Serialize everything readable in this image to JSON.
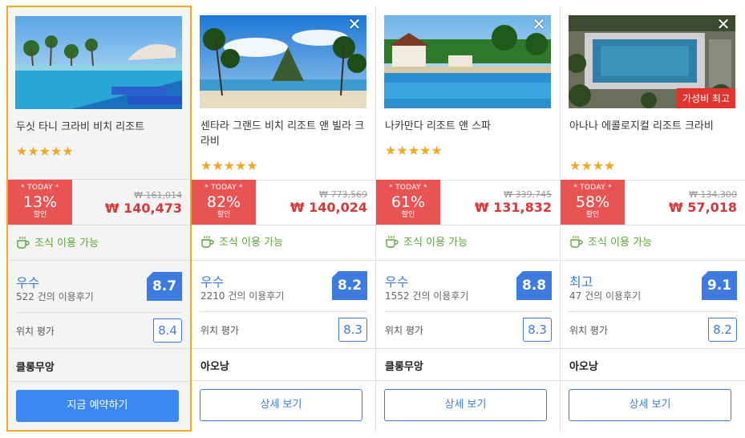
{
  "hotels": [
    {
      "name": "두싯 타니 크라비 비치 리조트",
      "stars": "★★★★★",
      "today_label": "* TODAY *",
      "discount": "13%",
      "discount_label": "할인",
      "original_price": "₩ 161,014",
      "price": "₩ 140,473",
      "breakfast": "조식 이용 가능",
      "grade": "우수",
      "reviews": "522 건의 이용후기",
      "score": "8.7",
      "location_label": "위치 평가",
      "location_score": "8.4",
      "area": "클롱무앙",
      "button": "지금 예약하기",
      "badge": ""
    },
    {
      "name": "센타라 그랜드 비치 리조트 앤 빌라 크라비",
      "stars": "★★★★★",
      "today_label": "* TODAY *",
      "discount": "82%",
      "discount_label": "할인",
      "original_price": "₩ 773,569",
      "price": "₩ 140,024",
      "breakfast": "조식 이용 가능",
      "grade": "우수",
      "reviews": "2210 건의 이용후기",
      "score": "8.2",
      "location_label": "위치 평가",
      "location_score": "8.3",
      "area": "아오낭",
      "button": "상세 보기",
      "badge": ""
    },
    {
      "name": "나카만다 리조트 앤 스파",
      "stars": "★★★★★",
      "today_label": "* TODAY *",
      "discount": "61%",
      "discount_label": "할인",
      "original_price": "₩ 339,745",
      "price": "₩ 131,832",
      "breakfast": "조식 이용 가능",
      "grade": "우수",
      "reviews": "1552 건의 이용후기",
      "score": "8.8",
      "location_label": "위치 평가",
      "location_score": "8.3",
      "area": "클롱무앙",
      "button": "상세 보기",
      "badge": ""
    },
    {
      "name": "아나나 에콜로지컬 리조트 크라비",
      "stars": "★★★★",
      "today_label": "* TODAY *",
      "discount": "58%",
      "discount_label": "할인",
      "original_price": "₩ 134,300",
      "price": "₩ 57,018",
      "breakfast": "조식 이용 가능",
      "grade": "최고",
      "reviews": "47 건의 이용후기",
      "score": "9.1",
      "location_label": "위치 평가",
      "location_score": "8.2",
      "area": "아오낭",
      "button": "상세 보기",
      "badge": "가성비 최고"
    }
  ],
  "close_glyph": "✕",
  "colors": {
    "accent": "#3d7be0",
    "sale": "#e85454",
    "highlight": "#f5a623",
    "breakfast": "#5aa839"
  }
}
